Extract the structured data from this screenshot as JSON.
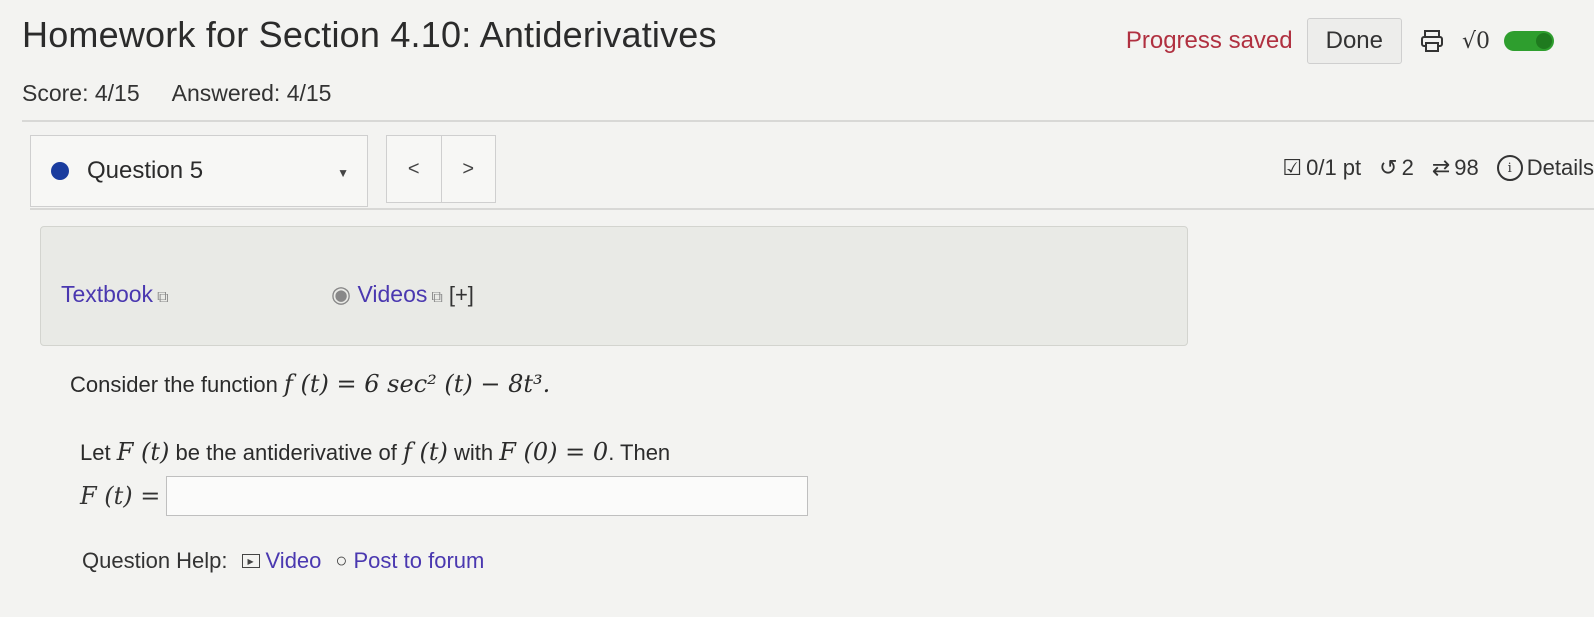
{
  "header": {
    "title": "Homework for Section 4.10: Antiderivatives",
    "progress": "Progress saved",
    "done_label": "Done",
    "sqrt_label": "√0"
  },
  "score": {
    "score_text": "Score: 4/15",
    "answered_text": "Answered: 4/15"
  },
  "question_nav": {
    "selected": "Question 5",
    "prev": "<",
    "next": ">",
    "points": "0/1 pt",
    "retries": "2",
    "attempts": "98",
    "details": "Details"
  },
  "resources": {
    "textbook": "Textbook",
    "videos": "Videos",
    "expand": "[+]"
  },
  "question": {
    "intro": "Consider the function",
    "function_expr": "f (t) = 6 sec² (t) − 8t³.",
    "let_text": "Let",
    "F_t": "F (t)",
    "be_text": "be the antiderivative of",
    "f_t": "f (t)",
    "with_text": "with",
    "cond": "F (0) = 0",
    "then_text": ". Then",
    "answer_label": "F (t) =",
    "answer_value": ""
  },
  "help": {
    "label": "Question Help:",
    "video": "Video",
    "forum": "Post to forum"
  }
}
